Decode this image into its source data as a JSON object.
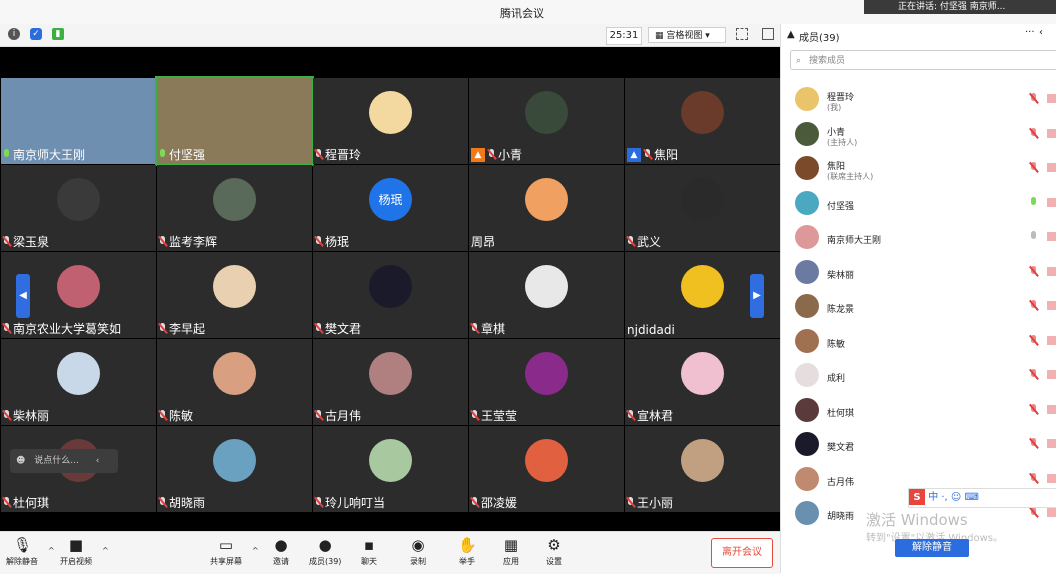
{
  "window": {
    "title": "腾讯会议",
    "speaking_popup": "正在讲话: 付坚强 南京师..."
  },
  "toolbar_top": {
    "timer": "25:31",
    "view_label": "宫格视图"
  },
  "tiles": [
    {
      "name": "南京师大王刚",
      "mic": "on"
    },
    {
      "name": "付坚强",
      "mic": "on"
    },
    {
      "name": "程晋玲",
      "mic": "muted"
    },
    {
      "name": "小青",
      "mic": "muted",
      "badge": "host"
    },
    {
      "name": "焦阳",
      "mic": "muted",
      "badge": "cohost"
    },
    {
      "name": "梁玉泉",
      "mic": "muted"
    },
    {
      "name": "监考李辉",
      "mic": "muted"
    },
    {
      "name": "杨珉",
      "mic": "muted",
      "avatar_text": "杨珉"
    },
    {
      "name": "周昂",
      "mic": "none"
    },
    {
      "name": "武义",
      "mic": "muted"
    },
    {
      "name": "南京农业大学葛笑如",
      "mic": "muted"
    },
    {
      "name": "李早起",
      "mic": "muted"
    },
    {
      "name": "樊文君",
      "mic": "muted"
    },
    {
      "name": "章棋",
      "mic": "muted"
    },
    {
      "name": "njdidadi",
      "mic": "none"
    },
    {
      "name": "柴林丽",
      "mic": "muted"
    },
    {
      "name": "陈敏",
      "mic": "muted"
    },
    {
      "name": "古月伟",
      "mic": "muted"
    },
    {
      "name": "王莹莹",
      "mic": "muted"
    },
    {
      "name": "宣林君",
      "mic": "muted"
    },
    {
      "name": "杜何琪",
      "mic": "muted"
    },
    {
      "name": "胡晓雨",
      "mic": "muted"
    },
    {
      "name": "玲儿响叮当",
      "mic": "muted"
    },
    {
      "name": "邵凌媛",
      "mic": "muted"
    },
    {
      "name": "王小丽",
      "mic": "muted"
    }
  ],
  "chat_input": {
    "placeholder": "说点什么..."
  },
  "bottombar": {
    "unmute": "解除静音",
    "start_video": "开启视频",
    "share": "共享屏幕",
    "invite": "邀请",
    "members": "成员(39)",
    "chat": "聊天",
    "record": "录制",
    "raise_hand": "举手",
    "apps": "应用",
    "settings": "设置",
    "leave": "离开会议"
  },
  "sidebar": {
    "header": "成员(39)",
    "search_placeholder": "搜索成员",
    "members": [
      {
        "name": "程晋玲",
        "role": "(我)",
        "mic": "muted",
        "color": "#e9c46a"
      },
      {
        "name": "小青",
        "role": "(主持人)",
        "mic": "muted",
        "color": "#4a5a3a"
      },
      {
        "name": "焦阳",
        "role": "(联席主持人)",
        "mic": "muted",
        "color": "#7a4a2a"
      },
      {
        "name": "付坚强",
        "role": "",
        "mic": "on",
        "color": "#4aa8c0"
      },
      {
        "name": "南京师大王刚",
        "role": "",
        "mic": "idle",
        "color": "#d99"
      },
      {
        "name": "柴林丽",
        "role": "",
        "mic": "muted",
        "color": "#6a7aa0"
      },
      {
        "name": "陈龙景",
        "role": "",
        "mic": "muted",
        "color": "#8a6a4a"
      },
      {
        "name": "陈敏",
        "role": "",
        "mic": "muted",
        "color": "#a07050"
      },
      {
        "name": "成利",
        "role": "",
        "mic": "muted",
        "color": "#e6dede"
      },
      {
        "name": "杜何琪",
        "role": "",
        "mic": "muted",
        "color": "#5a3a3a"
      },
      {
        "name": "樊文君",
        "role": "",
        "mic": "muted",
        "color": "#1a1a2a"
      },
      {
        "name": "古月伟",
        "role": "",
        "mic": "muted",
        "color": "#c08a70"
      },
      {
        "name": "胡晓雨",
        "role": "",
        "mic": "muted",
        "color": "#6a90b0"
      }
    ],
    "mute_all": "解除静音"
  },
  "os_overlay": {
    "activate": "激活 Windows",
    "activate_sub": "转到\"设置\"以激活 Windows。",
    "ime": "中 ·, ☺ ⌨"
  }
}
